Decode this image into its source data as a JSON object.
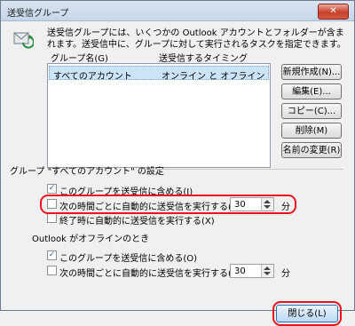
{
  "window": {
    "title": "送受信グループ",
    "close_label": "✕"
  },
  "description": "送受信グループには、いくつかの Outlook アカウントとフォルダーが含まれます。送受信中に、グループに対して実行されるタスクを指定できます。",
  "list": {
    "columns": [
      "グループ名(G)",
      "送受信するタイミング"
    ],
    "rows": [
      {
        "name": "すべてのアカウント",
        "timing": "オンライン と オフライン"
      }
    ]
  },
  "buttons": {
    "new": "新規作成(N)...",
    "edit": "編集(E)...",
    "copy": "コピー(C)...",
    "delete": "削除(M)",
    "rename": "名前の変更(R)",
    "close": "閉じる(L)"
  },
  "online_group": {
    "label": "グループ \"すべてのアカウント\" の設定",
    "include": {
      "label": "このグループを送受信に含める(I)",
      "checked": true
    },
    "schedule": {
      "label": "次の時間ごとに自動的に送受信を実行する(V)",
      "checked": false,
      "value": "30",
      "unit": "分"
    },
    "on_exit": {
      "label": "終了時に自動的に送受信を実行する(X)",
      "checked": false
    }
  },
  "offline_group": {
    "label": "Outlook がオフラインのとき",
    "include": {
      "label": "このグループを送受信に含める(O)",
      "checked": true
    },
    "schedule": {
      "label": "次の時間ごとに自動的に送受信を実行する(Y)",
      "checked": false,
      "value": "30",
      "unit": "分"
    }
  },
  "colors": {
    "highlight": "#e8141f",
    "selection": "#cce4f7"
  }
}
